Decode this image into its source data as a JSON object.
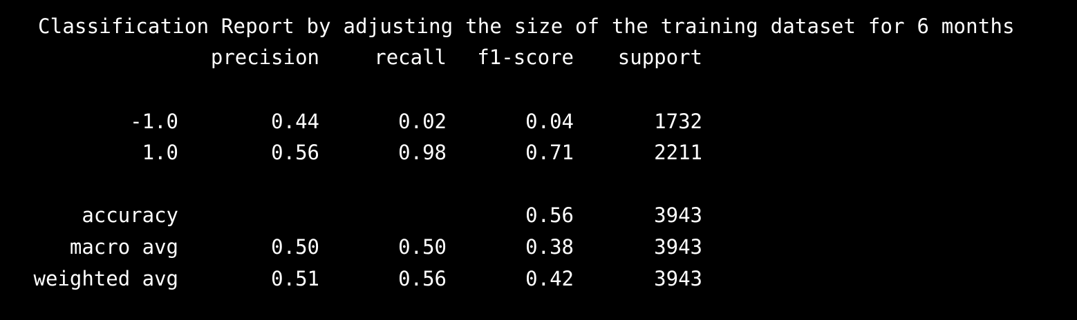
{
  "report": {
    "title": "Classification Report by adjusting the size of the training dataset for 6 months",
    "headers": {
      "precision": "precision",
      "recall": "recall",
      "f1": "f1-score",
      "support": "support"
    },
    "rows": [
      {
        "label": "-1.0",
        "precision": "0.44",
        "recall": "0.02",
        "f1": "0.04",
        "support": "1732"
      },
      {
        "label": "1.0",
        "precision": "0.56",
        "recall": "0.98",
        "f1": "0.71",
        "support": "2211"
      }
    ],
    "accuracy": {
      "label": "accuracy",
      "f1": "0.56",
      "support": "3943"
    },
    "macro": {
      "label": "macro avg",
      "precision": "0.50",
      "recall": "0.50",
      "f1": "0.38",
      "support": "3943"
    },
    "weighted": {
      "label": "weighted avg",
      "precision": "0.51",
      "recall": "0.56",
      "f1": "0.42",
      "support": "3943"
    }
  }
}
